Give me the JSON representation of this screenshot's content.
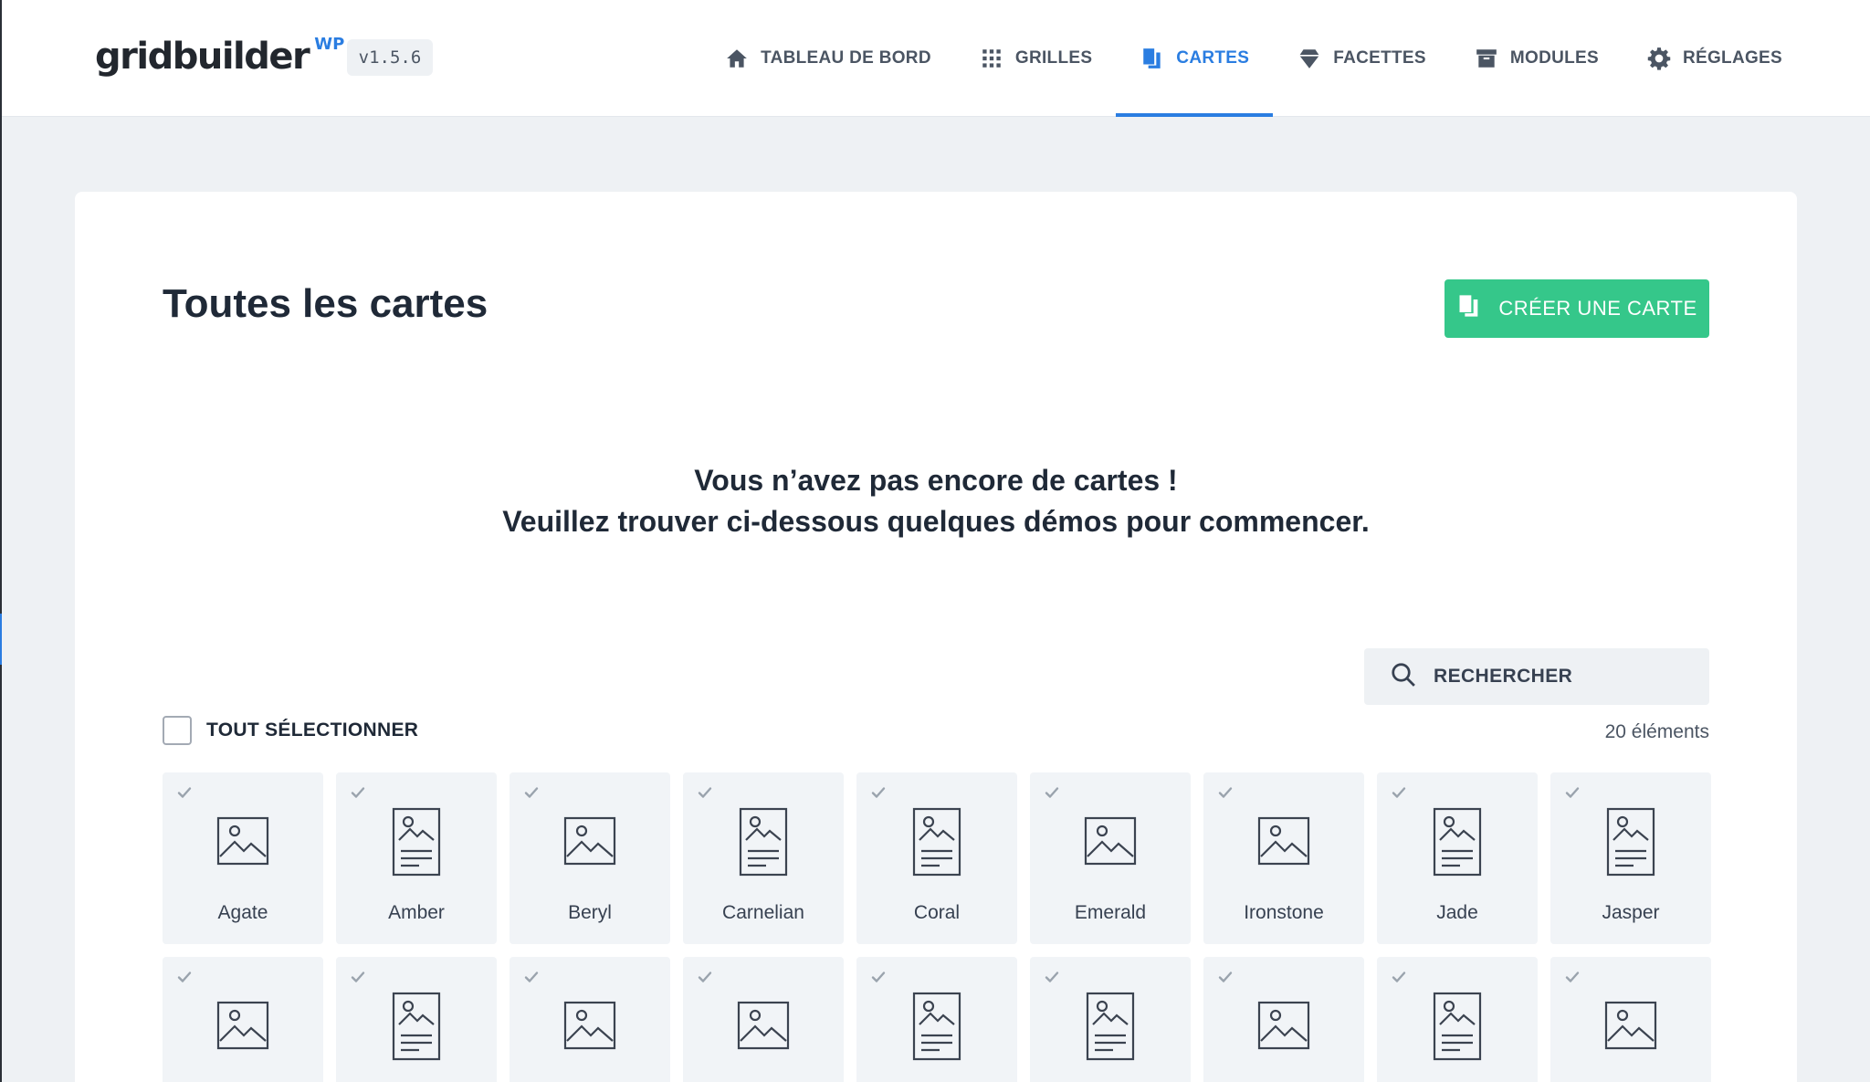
{
  "brand": {
    "name": "gridbuilder",
    "suffix": "WP",
    "version": "v1.5.6"
  },
  "nav": [
    {
      "label": "TABLEAU DE BORD",
      "icon": "home-icon",
      "active": false
    },
    {
      "label": "GRILLES",
      "icon": "grid-icon",
      "active": false
    },
    {
      "label": "CARTES",
      "icon": "cards-icon",
      "active": true
    },
    {
      "label": "FACETTES",
      "icon": "diamond-icon",
      "active": false
    },
    {
      "label": "MODULES",
      "icon": "archive-icon",
      "active": false
    },
    {
      "label": "RÉGLAGES",
      "icon": "gear-icon",
      "active": false
    }
  ],
  "page": {
    "title": "Toutes les cartes",
    "create_label": "CRÉER UNE CARTE",
    "empty_line1": "Vous n’avez pas encore de cartes !",
    "empty_line2": "Veuillez trouver ci-dessous quelques démos pour commencer."
  },
  "search": {
    "placeholder": "RECHERCHER"
  },
  "select_all_label": "TOUT SÉLECTIONNER",
  "count_label": "20 éléments",
  "cards": [
    {
      "name": "Agate",
      "icon": "image-icon"
    },
    {
      "name": "Amber",
      "icon": "image-text-icon"
    },
    {
      "name": "Beryl",
      "icon": "image-icon"
    },
    {
      "name": "Carnelian",
      "icon": "image-text-icon"
    },
    {
      "name": "Coral",
      "icon": "image-text-icon"
    },
    {
      "name": "Emerald",
      "icon": "image-icon"
    },
    {
      "name": "Ironstone",
      "icon": "image-icon"
    },
    {
      "name": "Jade",
      "icon": "image-text-icon"
    },
    {
      "name": "Jasper",
      "icon": "image-text-icon"
    },
    {
      "name": "",
      "icon": "image-icon"
    },
    {
      "name": "",
      "icon": "image-text-icon"
    },
    {
      "name": "",
      "icon": "image-icon"
    },
    {
      "name": "",
      "icon": "image-icon"
    },
    {
      "name": "",
      "icon": "image-text-icon"
    },
    {
      "name": "",
      "icon": "image-text-icon"
    },
    {
      "name": "",
      "icon": "image-icon"
    },
    {
      "name": "",
      "icon": "image-text-icon"
    },
    {
      "name": "",
      "icon": "image-icon"
    }
  ],
  "colors": {
    "accent": "#2a7de1",
    "create_button": "#35c78a",
    "background": "#eef1f4",
    "card": "#f1f4f7"
  }
}
